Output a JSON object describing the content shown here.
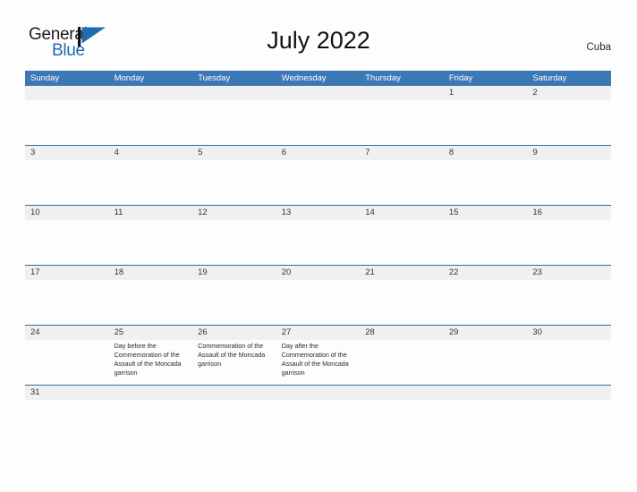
{
  "brand": {
    "name_part1": "General",
    "name_part2": "Blue",
    "flag_icon": "blue-flag-triangle-icon",
    "accent_color": "#1f6cb0"
  },
  "header": {
    "title": "July 2022",
    "country": "Cuba"
  },
  "theme": {
    "header_bar_color": "#3c78b4",
    "row_divider_color": "#2e6da4",
    "date_band_color": "#f0f0f0",
    "page_background": "#fdfdfd"
  },
  "weekdays": [
    "Sunday",
    "Monday",
    "Tuesday",
    "Wednesday",
    "Thursday",
    "Friday",
    "Saturday"
  ],
  "weeks": [
    {
      "days": [
        {
          "date": "",
          "event": ""
        },
        {
          "date": "",
          "event": ""
        },
        {
          "date": "",
          "event": ""
        },
        {
          "date": "",
          "event": ""
        },
        {
          "date": "",
          "event": ""
        },
        {
          "date": "1",
          "event": ""
        },
        {
          "date": "2",
          "event": ""
        }
      ]
    },
    {
      "days": [
        {
          "date": "3",
          "event": ""
        },
        {
          "date": "4",
          "event": ""
        },
        {
          "date": "5",
          "event": ""
        },
        {
          "date": "6",
          "event": ""
        },
        {
          "date": "7",
          "event": ""
        },
        {
          "date": "8",
          "event": ""
        },
        {
          "date": "9",
          "event": ""
        }
      ]
    },
    {
      "days": [
        {
          "date": "10",
          "event": ""
        },
        {
          "date": "11",
          "event": ""
        },
        {
          "date": "12",
          "event": ""
        },
        {
          "date": "13",
          "event": ""
        },
        {
          "date": "14",
          "event": ""
        },
        {
          "date": "15",
          "event": ""
        },
        {
          "date": "16",
          "event": ""
        }
      ]
    },
    {
      "days": [
        {
          "date": "17",
          "event": ""
        },
        {
          "date": "18",
          "event": ""
        },
        {
          "date": "19",
          "event": ""
        },
        {
          "date": "20",
          "event": ""
        },
        {
          "date": "21",
          "event": ""
        },
        {
          "date": "22",
          "event": ""
        },
        {
          "date": "23",
          "event": ""
        }
      ]
    },
    {
      "days": [
        {
          "date": "24",
          "event": ""
        },
        {
          "date": "25",
          "event": "Day before the Commemoration of the Assault of the Moncada garrison"
        },
        {
          "date": "26",
          "event": "Commemoration of the Assault of the Moncada garrison"
        },
        {
          "date": "27",
          "event": "Day after the Commemoration of the Assault of the Moncada garrison"
        },
        {
          "date": "28",
          "event": ""
        },
        {
          "date": "29",
          "event": ""
        },
        {
          "date": "30",
          "event": ""
        }
      ]
    },
    {
      "days": [
        {
          "date": "31",
          "event": ""
        },
        {
          "date": "",
          "event": ""
        },
        {
          "date": "",
          "event": ""
        },
        {
          "date": "",
          "event": ""
        },
        {
          "date": "",
          "event": ""
        },
        {
          "date": "",
          "event": ""
        },
        {
          "date": "",
          "event": ""
        }
      ]
    }
  ]
}
